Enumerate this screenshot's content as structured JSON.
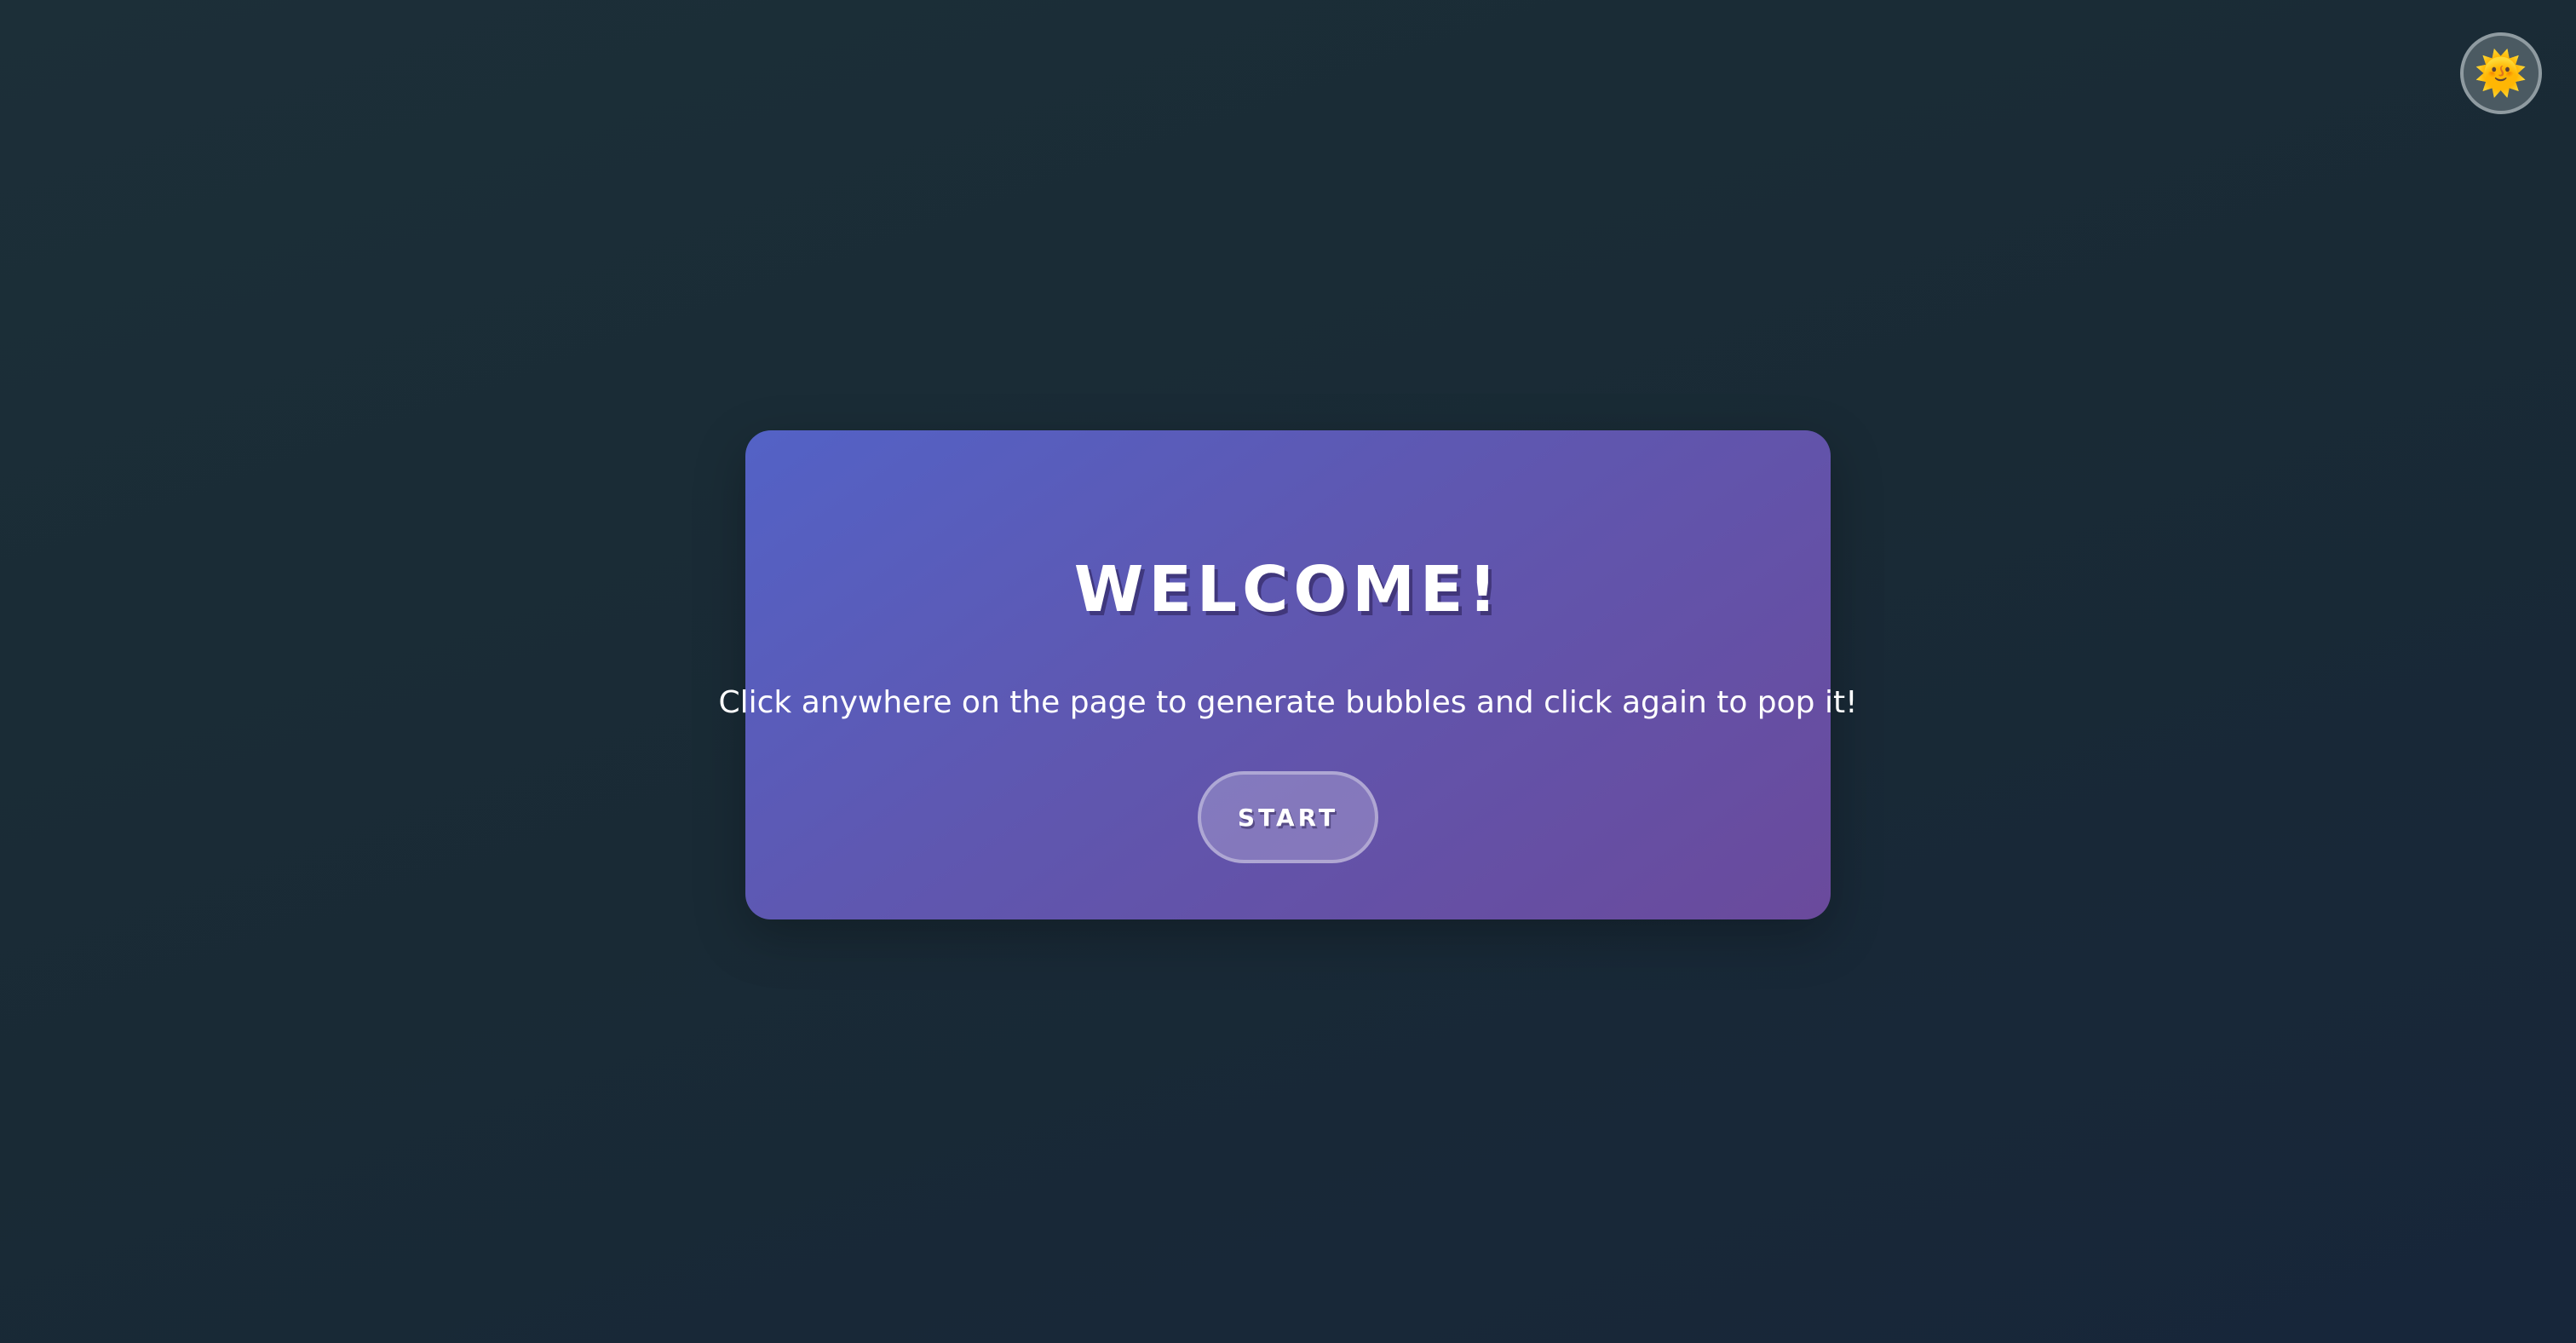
{
  "theme_toggle": {
    "icon": "sun-icon",
    "glyph": "🌞"
  },
  "welcome_modal": {
    "title": "WELCOME!",
    "message": "Click anywhere on the page to generate bubbles and click again to pop it!",
    "start_label": "START"
  },
  "colors": {
    "background": "#1b2c37",
    "modal_gradient_start": "#5362c6",
    "modal_gradient_end": "#6a4a9c",
    "text": "#ffffff"
  }
}
